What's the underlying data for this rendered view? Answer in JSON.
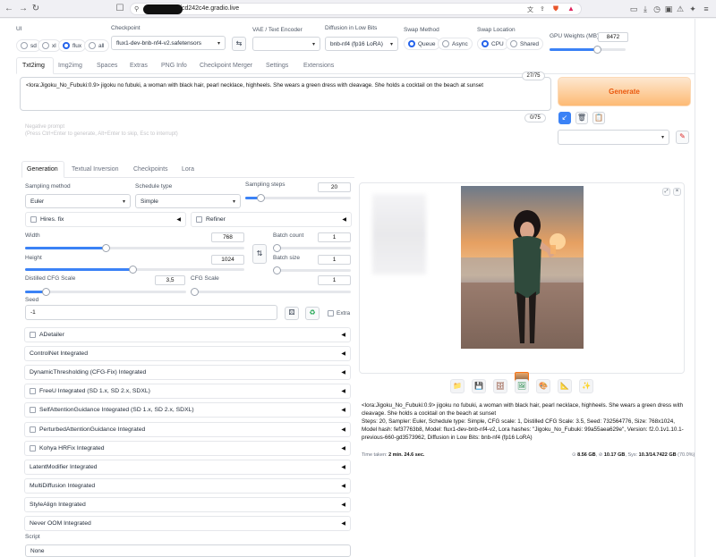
{
  "browser": {
    "url_suffix": "fcd242c4e.gradio.live"
  },
  "top": {
    "ui_label": "UI",
    "ui_options": [
      "sd",
      "xl",
      "flux",
      "all"
    ],
    "ui_selected": "flux",
    "checkpoint_label": "Checkpoint",
    "checkpoint_value": "flux1-dev-bnb-nf4-v2.safetensors",
    "vae_label": "VAE / Text Encoder",
    "vae_value": "",
    "diffusion_label": "Diffusion in Low Bits",
    "diffusion_value": "bnb-nf4 (fp16 LoRA)",
    "swap_method_label": "Swap Method",
    "swap_method_options": [
      "Queue",
      "Async"
    ],
    "swap_location_label": "Swap Location",
    "swap_location_options": [
      "CPU",
      "Shared"
    ],
    "gpu_weights_label": "GPU Weights (MB)",
    "gpu_weights_value": "8472",
    "gpu_weights_fraction": 0.62
  },
  "main_tabs": [
    "Txt2img",
    "Img2img",
    "Spaces",
    "Extras",
    "PNG Info",
    "Checkpoint Merger",
    "Settings",
    "Extensions"
  ],
  "prompt": {
    "text": "<lora:Jigoku_No_Fubuki:0.9> jigoku no fubuki, a woman with black hair, pearl necklace,  highheels. She wears a green dress with cleavage. She holds a cocktail on the beach at sunset",
    "counter": "27/75",
    "neg_placeholder": "Negative prompt\n(Press Ctrl+Enter to generate, Alt+Enter to skip, Esc to interrupt)",
    "neg_counter": "0/75"
  },
  "generate_label": "Generate",
  "sub_tabs": [
    "Generation",
    "Textual Inversion",
    "Checkpoints",
    "Lora"
  ],
  "gen": {
    "sampling_method_label": "Sampling method",
    "sampling_method_value": "Euler",
    "schedule_type_label": "Schedule type",
    "schedule_type_value": "Simple",
    "sampling_steps_label": "Sampling steps",
    "sampling_steps_value": "20",
    "hires_label": "Hires. fix",
    "refiner_label": "Refiner",
    "width_label": "Width",
    "width_value": "768",
    "height_label": "Height",
    "height_value": "1024",
    "batch_count_label": "Batch count",
    "batch_count_value": "1",
    "batch_size_label": "Batch size",
    "batch_size_value": "1",
    "distilled_cfg_label": "Distilled CFG Scale",
    "distilled_cfg_value": "3,5",
    "cfg_label": "CFG Scale",
    "cfg_value": "1",
    "seed_label": "Seed",
    "seed_value": "-1",
    "extra_label": "Extra"
  },
  "accordions": [
    {
      "label": "ADetailer",
      "checkbox": true
    },
    {
      "label": "ControlNet Integrated",
      "checkbox": false
    },
    {
      "label": "DynamicThresholding (CFG-Fix) Integrated",
      "checkbox": false
    },
    {
      "label": "FreeU Integrated (SD 1.x, SD 2.x, SDXL)",
      "checkbox": true
    },
    {
      "label": "SelfAttentionGuidance Integrated (SD 1.x, SD 2.x, SDXL)",
      "checkbox": true
    },
    {
      "label": "PerturbedAttentionGuidance Integrated",
      "checkbox": true
    },
    {
      "label": "Kohya HRFix Integrated",
      "checkbox": true
    },
    {
      "label": "LatentModifier Integrated",
      "checkbox": false
    },
    {
      "label": "MultiDiffusion Integrated",
      "checkbox": false
    },
    {
      "label": "StyleAlign Integrated",
      "checkbox": false
    },
    {
      "label": "Never OOM Integrated",
      "checkbox": false
    }
  ],
  "script_label": "Script",
  "script_value": "None",
  "output": {
    "info_line1": "<lora:Jigoku_No_Fubuki:0.9> jigoku no fubuki, a woman with black hair, pearl necklace, highheels. She wears a green dress with cleavage. She holds a cocktail on the beach at sunset",
    "info_line2": "Steps: 20, Sampler: Euler, Schedule type: Simple, CFG scale: 1, Distilled CFG Scale: 3.5, Seed: 732564776, Size: 768x1024, Model hash: fef37763b8, Model: flux1-dev-bnb-nf4-v2, Lora hashes: \"Jigoku_No_Fubuki: 99a55aea629e\", Version: f2.0.1v1.10.1-previous-660-gd3573962, Diffusion in Low Bits: bnb-nf4 (fp16 LoRA)",
    "time_label": "Time taken:",
    "time_value": "2 min. 24.6 sec.",
    "mem_a": "8.56 GB",
    "mem_r": "10.17 GB",
    "mem_sys_label": "Sys:",
    "mem_sys": "10.3/14.7422 GB",
    "mem_pct": "(70.0%)"
  },
  "colors": {
    "accent": "#2563eb",
    "generate_from": "#fde7cf",
    "generate_to": "#fdba74",
    "generate_text": "#ea580c"
  }
}
